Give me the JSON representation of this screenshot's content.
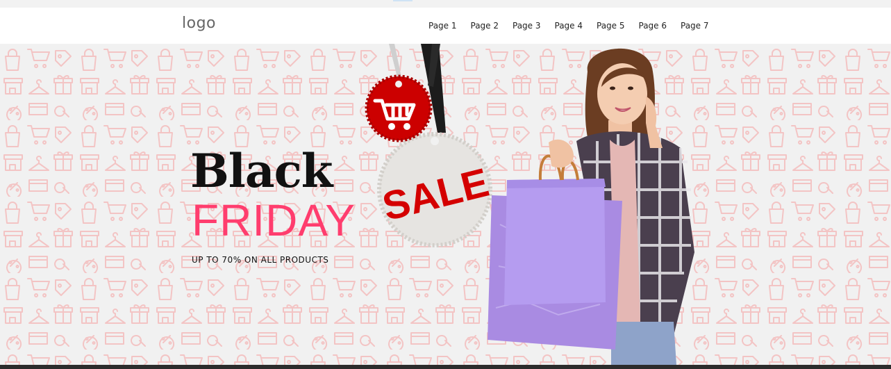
{
  "header": {
    "logo": "logo",
    "nav": [
      "Page 1",
      "Page 2",
      "Page 3",
      "Page 4",
      "Page 5",
      "Page 6",
      "Page 7"
    ]
  },
  "hero": {
    "title_line1": "Black",
    "title_line2": "FRIDAY",
    "subtitle": "UP TO 70% ON ALL PRODUCTS",
    "tag_text": "SALE",
    "colors": {
      "accent_pink": "#ff3d6e",
      "tag_red": "#cc0000",
      "pattern": "#f3c4c4",
      "bag_purple": "#b59cf0"
    },
    "icons": [
      "shopping-cart-icon",
      "shopping-bag-icon",
      "price-tag-icon",
      "store-icon",
      "hanger-icon",
      "gift-icon",
      "percent-icon",
      "credit-card-icon",
      "search-icon",
      "receipt-icon"
    ]
  }
}
